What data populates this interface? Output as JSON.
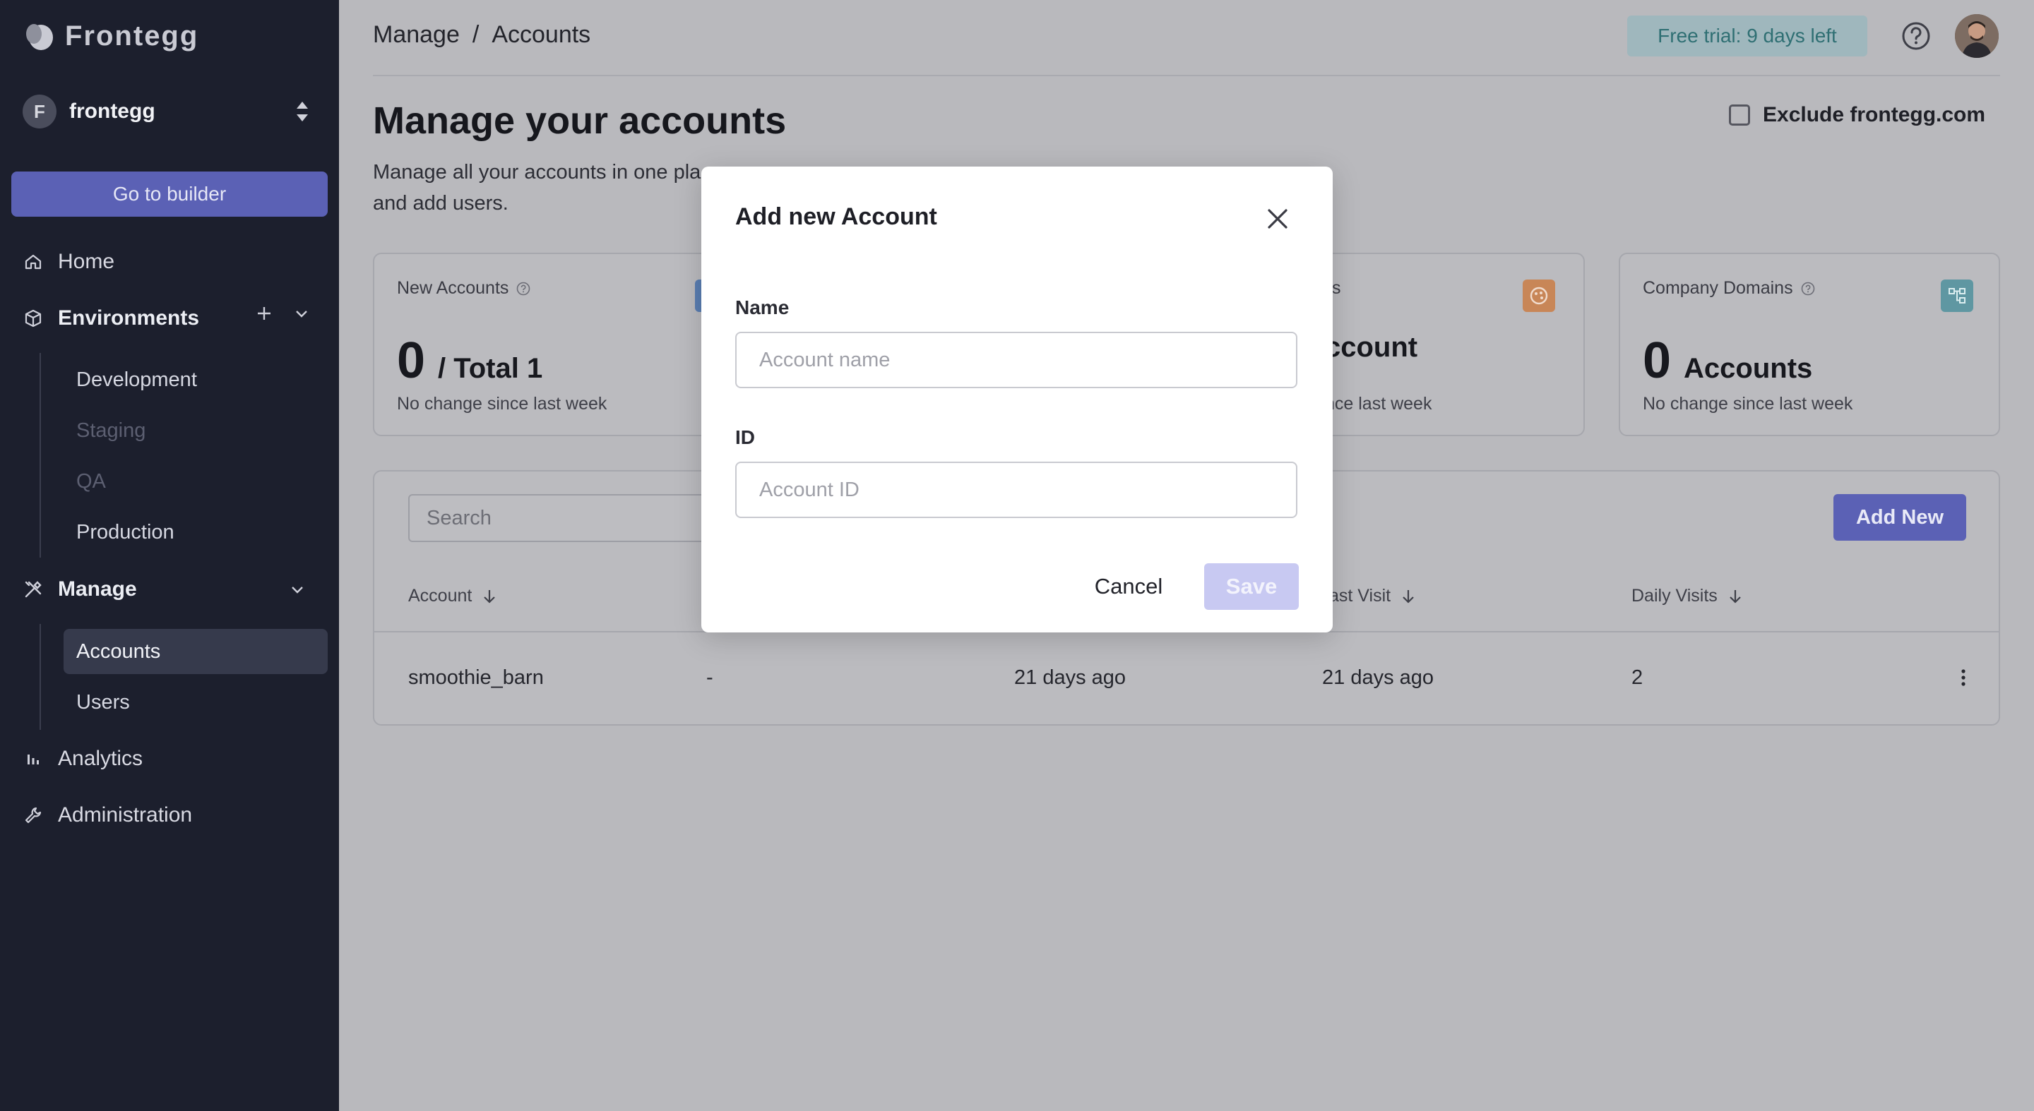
{
  "brand": {
    "name": "Frontegg"
  },
  "workspace": {
    "initial": "F",
    "name": "frontegg"
  },
  "sidebar": {
    "builder_label": "Go to builder",
    "home": "Home",
    "environments": "Environments",
    "env_items": [
      "Development",
      "Staging",
      "QA",
      "Production"
    ],
    "manage": "Manage",
    "manage_items": [
      "Accounts",
      "Users"
    ],
    "analytics": "Analytics",
    "administration": "Administration"
  },
  "topbar": {
    "breadcrumb_root": "Manage",
    "breadcrumb_sep": "/",
    "breadcrumb_current": "Accounts",
    "trial": "Free trial: 9 days left"
  },
  "page": {
    "title": "Manage your accounts",
    "description": "Manage all your accounts in one pla",
    "description_line2": "and add users.",
    "exclude_label": "Exclude frontegg.com"
  },
  "cards": [
    {
      "title": "New Accounts",
      "value": "0",
      "unit": "/ Total 1",
      "sub": "No change since last week"
    },
    {
      "title": "s",
      "value": "",
      "unit": "ccount",
      "sub": "nce last week"
    },
    {
      "title": "Company Domains",
      "value": "0",
      "unit": "Accounts",
      "sub": "No change since last week"
    }
  ],
  "table": {
    "search_placeholder": "Search",
    "add_new": "Add New",
    "headers": [
      "Account",
      "ast Visit",
      "Daily Visits"
    ],
    "rows": [
      {
        "account": "smoothie_barn",
        "col2": "-",
        "col3": "21 days ago",
        "last_visit": "21 days ago",
        "daily_visits": "2"
      }
    ]
  },
  "modal": {
    "title": "Add new Account",
    "name_label": "Name",
    "name_placeholder": "Account name",
    "id_label": "ID",
    "id_placeholder": "Account ID",
    "cancel": "Cancel",
    "save": "Save"
  },
  "colors": {
    "sidebar_bg": "#1c1f2d",
    "accent": "#5b61b5",
    "save_disabled": "#c8c9f2",
    "trial_bg": "#9fb7bd"
  }
}
